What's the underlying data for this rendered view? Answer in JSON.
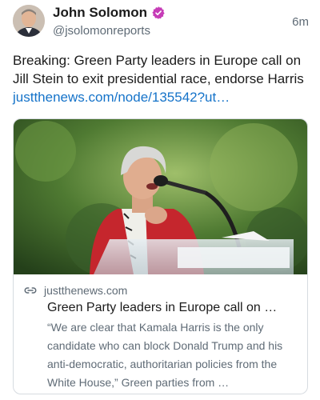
{
  "author": {
    "display_name": "John Solomon",
    "handle": "@jsolomonreports",
    "avatar_icon": "avatar-photo",
    "verified_icon": "verified-badge-icon",
    "verified_color": "#c63cb7"
  },
  "post": {
    "time_ago": "6m",
    "text": "Breaking: Green Party leaders in Europe call on Jill Stein to exit presidential race, endorse Harris ",
    "link_text": "justthenews.com/node/135542?ut…",
    "link_color": "#1573c9"
  },
  "link_card": {
    "image_icon": "speaker-at-podium-photo",
    "link_icon": "link-icon",
    "domain": "justthenews.com",
    "title": "Green Party leaders in Europe call on …",
    "description": "“We are clear that Kamala Harris is the only candidate who can block Donald Trump and his anti-democratic, authoritarian policies from the White House,” Green parties from …"
  }
}
